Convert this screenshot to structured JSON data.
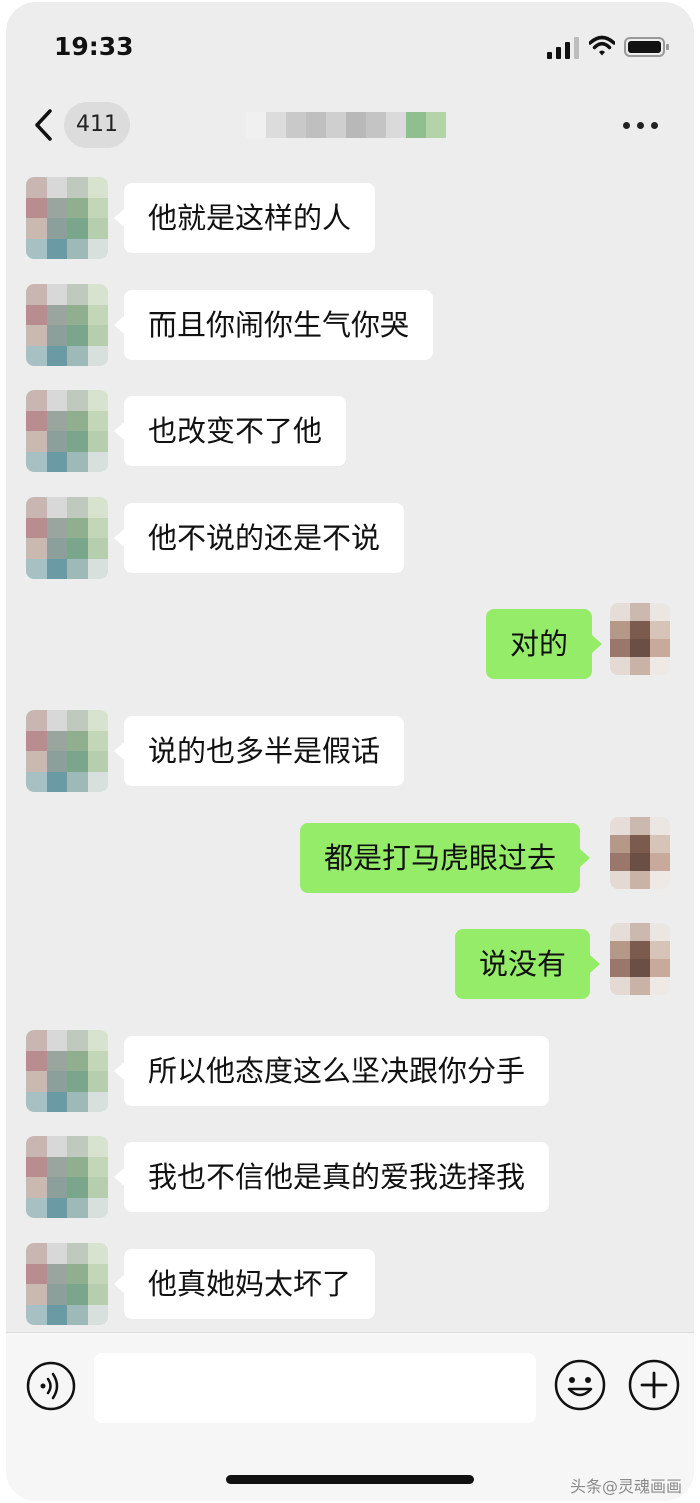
{
  "status_bar": {
    "time": "19:33"
  },
  "nav": {
    "unread_count": "411"
  },
  "messages": [
    {
      "side": "left",
      "text": "他就是这样的人"
    },
    {
      "side": "left",
      "text": "而且你闹你生气你哭"
    },
    {
      "side": "left",
      "text": "也改变不了他"
    },
    {
      "side": "left",
      "text": "他不说的还是不说"
    },
    {
      "side": "right",
      "text": "对的"
    },
    {
      "side": "left",
      "text": "说的也多半是假话"
    },
    {
      "side": "right",
      "text": "都是打马虎眼过去"
    },
    {
      "side": "right",
      "text": "说没有"
    },
    {
      "side": "left",
      "text": "所以他态度这么坚决跟你分手"
    },
    {
      "side": "left",
      "text": "我也不信他是真的爱我选择我"
    },
    {
      "side": "left",
      "text": "他真她妈太坏了"
    }
  ],
  "input": {
    "placeholder": ""
  },
  "watermark": "头条@灵魂画画",
  "icons": {
    "back": "chevron-left-icon",
    "more": "more-horizontal-icon",
    "voice": "voice-icon",
    "emoji": "emoji-icon",
    "plus": "plus-circle-icon"
  },
  "colors": {
    "background": "#ededed",
    "bubble_self": "#95ec69",
    "bubble_other": "#ffffff",
    "avatar_other_tiles": [
      "#c9b6b3",
      "#d8d8d8",
      "#bfc9bd",
      "#d7e2cf",
      "#b98d90",
      "#9aa5a0",
      "#8faf8f",
      "#c3d7b8",
      "#c9b9b0",
      "#8d9f9a",
      "#7aa68b",
      "#b7ceae",
      "#a7c0c3",
      "#6a9aa3",
      "#9db9b8",
      "#d7e0dc"
    ],
    "avatar_self_tiles": [
      "#e7ddd8",
      "#cbb8ae",
      "#ece6e2",
      "#b59888",
      "#7c5b4f",
      "#d6c4b8",
      "#9a776a",
      "#6b4f45",
      "#c8aa9c",
      "#e5d9d3",
      "#c9b2a6",
      "#efe9e6"
    ],
    "title_tiles": [
      "#f0f0f0",
      "#dcdcdc",
      "#c9c9c9",
      "#bfbfbf",
      "#cfcfcf",
      "#b8b8b8",
      "#c4c4c4",
      "#dadada",
      "#8fbf8f",
      "#b5d3a8"
    ]
  }
}
